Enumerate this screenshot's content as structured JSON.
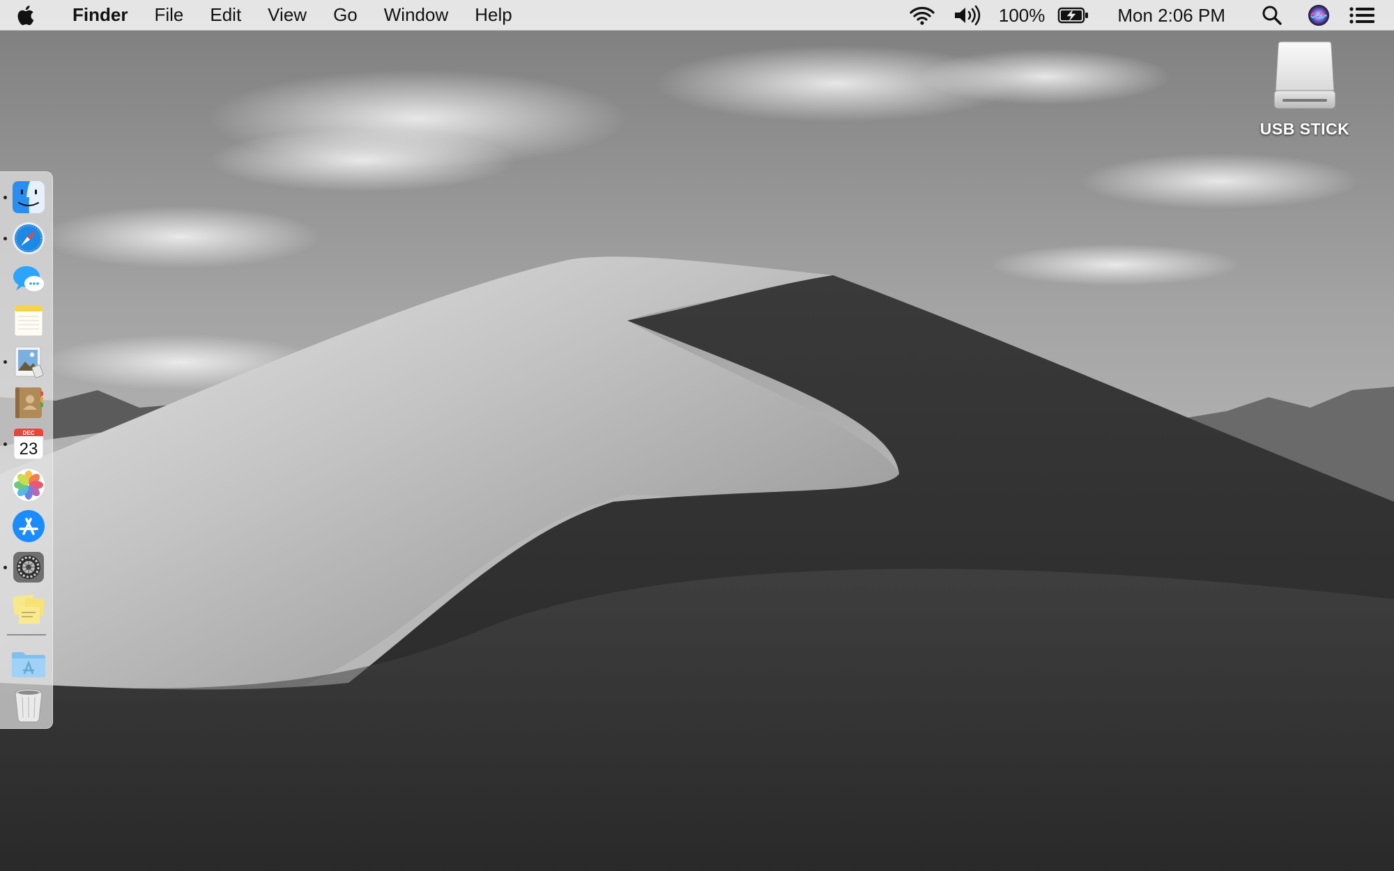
{
  "menubar": {
    "apple_icon": "apple-logo-icon",
    "app_name": "Finder",
    "menus": [
      "File",
      "Edit",
      "View",
      "Go",
      "Window",
      "Help"
    ],
    "status": {
      "wifi_icon": "wifi-icon",
      "volume_icon": "volume-icon",
      "battery_percent": "100%",
      "battery_icon": "battery-charging-icon",
      "clock": "Mon 2:06 PM",
      "spotlight_icon": "search-icon",
      "siri_icon": "siri-icon",
      "notification_center_icon": "notification-list-icon"
    }
  },
  "dock": {
    "items": [
      {
        "name": "Finder",
        "icon": "finder-icon",
        "running": true
      },
      {
        "name": "Safari",
        "icon": "safari-icon",
        "running": true
      },
      {
        "name": "Messages",
        "icon": "messages-icon",
        "running": false
      },
      {
        "name": "Notes",
        "icon": "notes-icon",
        "running": false
      },
      {
        "name": "Preview",
        "icon": "preview-icon",
        "running": true
      },
      {
        "name": "Contacts",
        "icon": "contacts-icon",
        "running": false
      },
      {
        "name": "Calendar",
        "icon": "calendar-icon",
        "running": true,
        "month": "DEC",
        "day": "23"
      },
      {
        "name": "Photos",
        "icon": "photos-icon",
        "running": false
      },
      {
        "name": "App Store",
        "icon": "app-store-icon",
        "running": false
      },
      {
        "name": "System Preferences",
        "icon": "system-preferences-icon",
        "running": true
      },
      {
        "name": "Stickies",
        "icon": "stickies-icon",
        "running": false
      },
      {
        "name": "Applications",
        "icon": "applications-folder-icon",
        "running": false
      },
      {
        "name": "Trash",
        "icon": "trash-icon",
        "running": false
      }
    ]
  },
  "desktop": {
    "icons": [
      {
        "label": "USB STICK",
        "icon": "external-drive-icon"
      }
    ]
  },
  "colors": {
    "menubar_bg": "#ececec",
    "dock_bg": "#e1e1e1",
    "safari_blue": "#1e88e5",
    "messages_blue": "#2aa4ff",
    "app_store_blue": "#1a8cff"
  }
}
